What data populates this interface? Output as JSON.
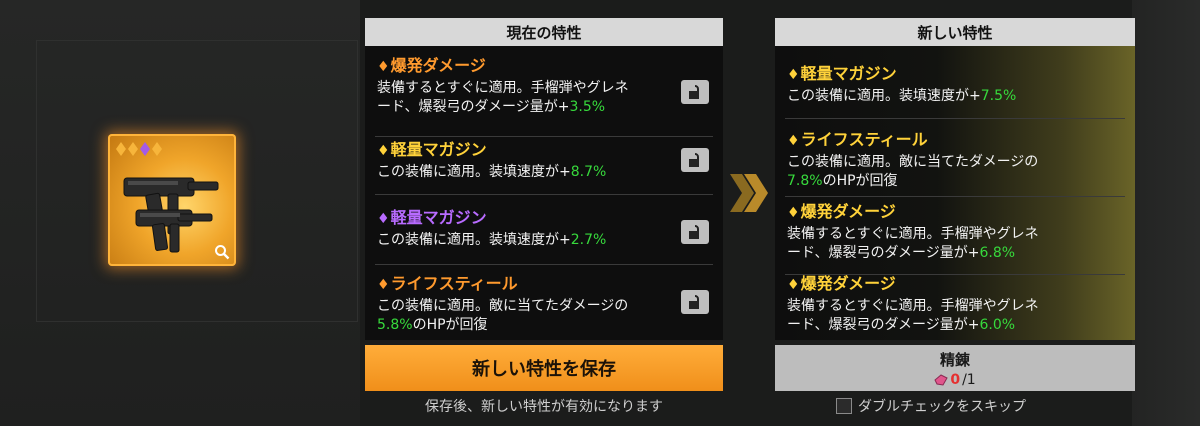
{
  "current_panel": {
    "header": "現在の特性",
    "traits": [
      {
        "name": "爆発ダメージ",
        "tier": "orange",
        "desc_1": "装備するとすぐに適用。手榴弾やグレネ",
        "desc_2": "ード、爆裂弓のダメージ量が+",
        "value": "3.5%"
      },
      {
        "name": "軽量マガジン",
        "tier": "gold",
        "desc_1": "この装備に適用。装填速度が+",
        "value": "8.7%"
      },
      {
        "name": "軽量マガジン",
        "tier": "purple",
        "desc_1": "この装備に適用。装填速度が+",
        "value": "2.7%"
      },
      {
        "name": "ライフスティール",
        "tier": "orange",
        "desc_1": "この装備に適用。敵に当てたダメージの",
        "value": "5.8%",
        "desc_2": "のHPが回復"
      }
    ]
  },
  "new_panel": {
    "header": "新しい特性",
    "traits": [
      {
        "name": "軽量マガジン",
        "desc_1": "この装備に適用。装填速度が+",
        "value": "7.5%"
      },
      {
        "name": "ライフスティール",
        "desc_1": "この装備に適用。敵に当てたダメージの",
        "value": "7.8%",
        "desc_2": "のHPが回復"
      },
      {
        "name": "爆発ダメージ",
        "desc_1": "装備するとすぐに適用。手榴弾やグレネ",
        "desc_2": "ード、爆裂弓のダメージ量が+",
        "value": "6.8%"
      },
      {
        "name": "爆発ダメージ",
        "desc_1": "装備するとすぐに適用。手榴弾やグレネ",
        "desc_2": "ード、爆裂弓のダメージ量が+",
        "value": "6.0%"
      }
    ]
  },
  "actions": {
    "save_label": "新しい特性を保存",
    "save_note": "保存後、新しい特性が有効になります",
    "refine_label": "精錬",
    "refine_have": "0",
    "refine_need": "/1",
    "skip_label": "ダブルチェックをスキップ"
  },
  "colors": {
    "accent_orange": "#f5a02e",
    "percent_green": "#37d93c",
    "tier_gold": "#ffd23a",
    "tier_orange": "#ff9a2e",
    "tier_purple": "#b86bff"
  },
  "icons": {
    "diamond": "♦",
    "lock": "padlock-icon",
    "magnifier": "magnifier-icon",
    "chevron": "double-chevron-icon"
  }
}
